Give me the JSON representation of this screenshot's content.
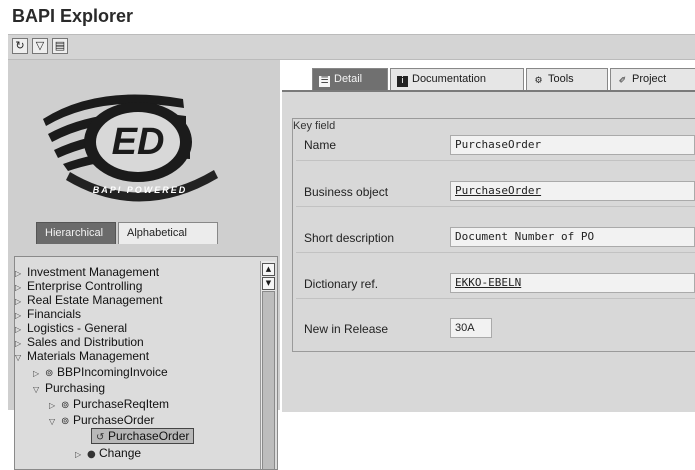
{
  "window": {
    "title": "BAPI Explorer"
  },
  "toolbar": {
    "buttons": [
      "refresh-icon",
      "filter-icon",
      "layout-icon"
    ]
  },
  "logo": {
    "mark": "ED",
    "arc_text": "BAPI POWERED"
  },
  "left_tabs": [
    "Hierarchical",
    "Alphabetical"
  ],
  "tree": {
    "items": [
      {
        "label": "Investment Management"
      },
      {
        "label": "Enterprise Controlling"
      },
      {
        "label": "Real Estate Management"
      },
      {
        "label": "Financials"
      },
      {
        "label": "Logistics - General"
      },
      {
        "label": "Sales and Distribution"
      },
      {
        "label": "Materials Management"
      },
      {
        "label": "BBPIncomingInvoice"
      },
      {
        "label": "Purchasing"
      },
      {
        "label": "PurchaseReqItem"
      },
      {
        "label": "PurchaseOrder"
      },
      {
        "label": "PurchaseOrder"
      },
      {
        "label": "Change"
      }
    ]
  },
  "right_tabs": [
    "Detail",
    "Documentation",
    "Tools",
    "Project"
  ],
  "detail": {
    "group_title": "Key field",
    "fields": [
      {
        "label": "Name",
        "value": "PurchaseOrder"
      },
      {
        "label": "Business object",
        "value": "PurchaseOrder"
      },
      {
        "label": "Short description",
        "value": "Document Number of PO"
      },
      {
        "label": "Dictionary ref.",
        "value": "EKKO-EBELN"
      },
      {
        "label": "New in Release",
        "value": "30A"
      }
    ]
  }
}
